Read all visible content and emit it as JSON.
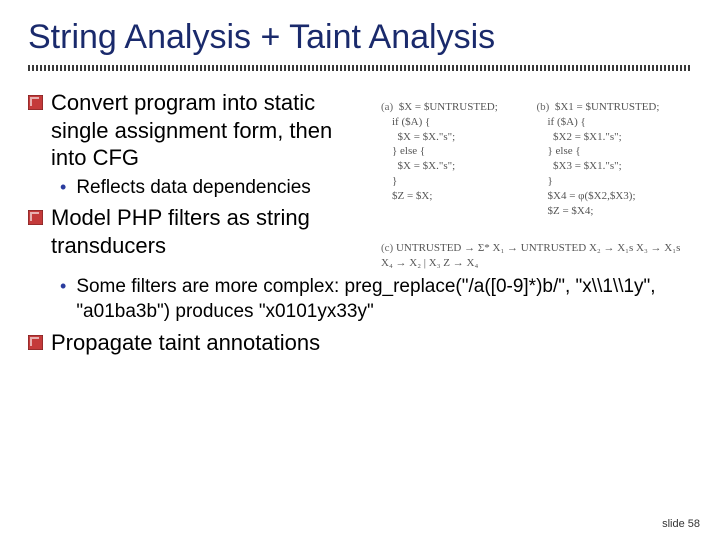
{
  "title": "String Analysis + Taint Analysis",
  "bullets": {
    "b1": "Convert program into static single assignment form, then into CFG",
    "b1_1": "Reflects data dependencies",
    "b2": "Model PHP filters as string transducers",
    "b2_1": "Some filters are more complex: preg_replace(\"/a([0-9]*)b/\", \"x\\\\1\\\\1y\", \"a01ba3b\") produces \"x0101yx33y\"",
    "b3": "Propagate taint annotations"
  },
  "code": {
    "label_a": "(a)",
    "label_b": "(b)",
    "label_c": "(c)",
    "a1": "$X = $UNTRUSTED;",
    "a2": "if ($A) {",
    "a3": "  $X = $X.\"s\";",
    "a4": "} else {",
    "a5": "  $X = $X.\"s\";",
    "a6": "}",
    "a7": "$Z = $X;",
    "b1": "$X1 = $UNTRUSTED;",
    "b2": "if ($A) {",
    "b3": "  $X2 = $X1.\"s\";",
    "b4": "} else {",
    "b5": "  $X3 = $X1.\"s\";",
    "b6": "}",
    "b7": "$X4 = φ($X2,$X3);",
    "b8": "$Z = $X4;",
    "g0": "UNTRUSTED → Σ*",
    "g1": "X₁         → UNTRUSTED",
    "g2": "X₂         → X₁s",
    "g3": "X₃         → X₁s",
    "g4": "X₄         → X₂ | X₃",
    "g5": "Z          → X₄"
  },
  "footer": "slide 58"
}
